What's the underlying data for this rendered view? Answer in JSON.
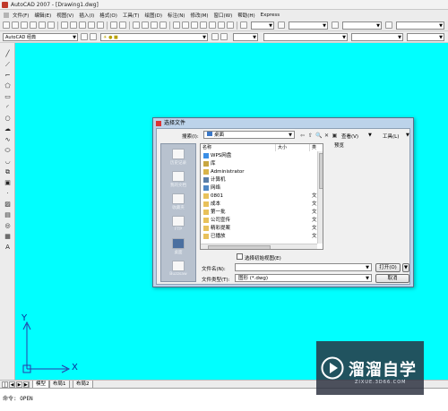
{
  "titlebar": {
    "title": "AutoCAD 2007 - [Drawing1.dwg]"
  },
  "menubar": {
    "items": [
      "文件(F)",
      "编辑(E)",
      "视图(V)",
      "插入(I)",
      "格式(O)",
      "工具(T)",
      "绘图(D)",
      "标注(N)",
      "修改(M)",
      "窗口(W)",
      "帮助(H)",
      "Express"
    ]
  },
  "toolbar": {
    "workspace": "AutoCAD 经典"
  },
  "canvas": {
    "background": "#00ffff",
    "ucs_x_label": "X",
    "ucs_y_label": "Y"
  },
  "layout_tabs": {
    "tabs": [
      "模型",
      "布局1",
      "布局2"
    ]
  },
  "command_line": {
    "text": "命令: OPEN"
  },
  "dialog": {
    "title": "选择文件",
    "lookin_label": "搜索(I):",
    "lookin_value": "桌面",
    "views_label": "查看(V)",
    "tools_label": "工具(L)",
    "preview_label": "预览",
    "columns": {
      "name": "名称",
      "size": "大小",
      "type": "类"
    },
    "places": [
      "历史记录",
      "我的文档",
      "收藏夹",
      "FTP",
      "桌面",
      "Buzzsaw"
    ],
    "files": [
      {
        "name": "WPS网盘",
        "type": "",
        "icon": "cloud-icon"
      },
      {
        "name": "库",
        "type": "",
        "icon": "library-icon"
      },
      {
        "name": "Administrator",
        "type": "",
        "icon": "user-folder-icon"
      },
      {
        "name": "计算机",
        "type": "",
        "icon": "computer-icon"
      },
      {
        "name": "网络",
        "type": "",
        "icon": "network-icon"
      },
      {
        "name": "0801",
        "type": "文",
        "icon": "folder-icon"
      },
      {
        "name": "成本",
        "type": "文",
        "icon": "folder-icon"
      },
      {
        "name": "第一批",
        "type": "文",
        "icon": "folder-icon"
      },
      {
        "name": "公司宣传",
        "type": "文",
        "icon": "folder-icon"
      },
      {
        "name": "精彩提案",
        "type": "文",
        "icon": "folder-icon"
      },
      {
        "name": "已播放",
        "type": "文",
        "icon": "folder-icon"
      }
    ],
    "initial_view_label": "选择初始视图(E)",
    "filename_label": "文件名(N):",
    "filename_value": "",
    "filetype_label": "文件类型(T):",
    "filetype_value": "图形 (*.dwg)",
    "open_label": "打开(O)",
    "cancel_label": "取消"
  },
  "watermark": {
    "text": "溜溜自学",
    "subtext": "ZIXUE.3D66.COM"
  }
}
